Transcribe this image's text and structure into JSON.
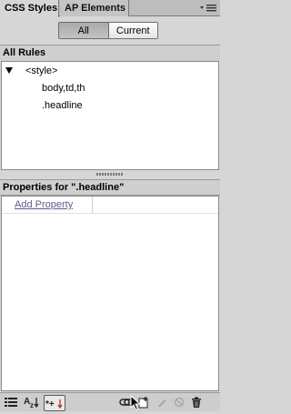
{
  "tabs": [
    {
      "label": "CSS Styles",
      "active": true
    },
    {
      "label": "AP Elements",
      "active": false
    }
  ],
  "mode_switch": {
    "all_label": "All",
    "current_label": "Current",
    "selected": "All"
  },
  "all_rules": {
    "header": "All Rules",
    "items": [
      {
        "label": "<style>",
        "expanded": true
      },
      {
        "label": "body,td,th"
      },
      {
        "label": ".headline"
      }
    ]
  },
  "properties": {
    "header": "Properties for \".headline\"",
    "add_property": "Add Property"
  },
  "toolbar": {
    "icons": [
      "category-view-icon",
      "alphabetical-view-icon",
      "show-set-properties-icon",
      "attach-stylesheet-icon",
      "new-css-rule-icon",
      "edit-rule-icon",
      "disable-property-icon",
      "delete-rule-icon"
    ]
  },
  "colors": {
    "panel_bg": "#d6d6d6",
    "content_bg": "#ffffff",
    "link": "#5c5c8a"
  }
}
